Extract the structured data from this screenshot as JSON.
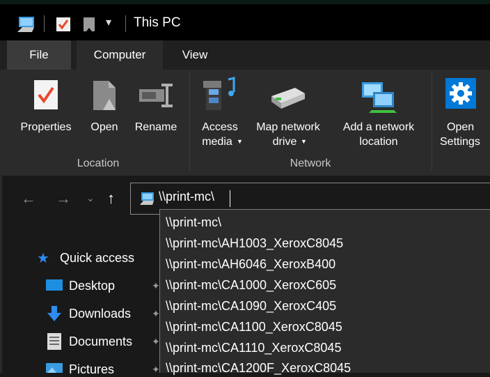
{
  "window": {
    "title": "This PC"
  },
  "tabs": [
    {
      "label": "File"
    },
    {
      "label": "Computer"
    },
    {
      "label": "View"
    }
  ],
  "ribbon": {
    "location": {
      "group_label": "Location",
      "properties": "Properties",
      "open": "Open",
      "rename": "Rename"
    },
    "network": {
      "group_label": "Network",
      "access_media_l1": "Access",
      "access_media_l2": "media",
      "map_drive_l1": "Map network",
      "map_drive_l2": "drive",
      "add_location_l1": "Add a network",
      "add_location_l2": "location"
    },
    "system": {
      "open_settings_l1": "Open",
      "open_settings_l2": "Settings"
    }
  },
  "address": {
    "value": "\\\\print-mc\\"
  },
  "suggestions": [
    "\\\\print-mc\\",
    "\\\\print-mc\\AH1003_XeroxC8045",
    "\\\\print-mc\\AH6046_XeroxB400",
    "\\\\print-mc\\CA1000_XeroxC605",
    "\\\\print-mc\\CA1090_XeroxC405",
    "\\\\print-mc\\CA1100_XeroxC8045",
    "\\\\print-mc\\CA1110_XeroxC8045",
    "\\\\print-mc\\CA1200F_XeroxC8045"
  ],
  "sidebar": {
    "quick_access": "Quick access",
    "items": [
      "Desktop",
      "Downloads",
      "Documents",
      "Pictures"
    ]
  },
  "colors": {
    "accent": "#0078d7",
    "ribbon_bg": "#2b2b2b",
    "dropdown_bg": "#2b2b2b",
    "titlebar_bg": "#000000"
  }
}
